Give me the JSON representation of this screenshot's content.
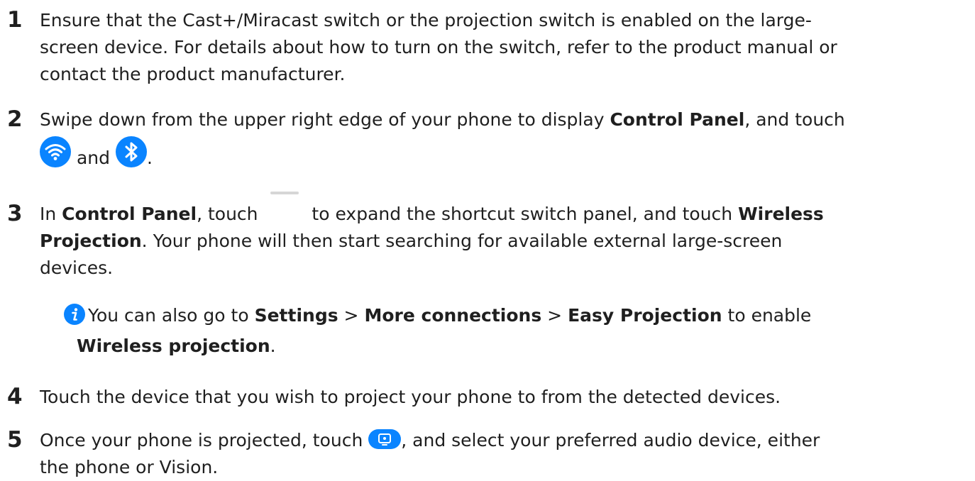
{
  "steps": [
    {
      "number": "1",
      "line1": "Ensure that the Cast+/Miracast switch or the projection switch is enabled on the large-",
      "line2": "screen device. For details about how to turn on the switch, refer to the product manual or",
      "line3": "contact the product manufacturer."
    },
    {
      "number": "2",
      "pre": "Swipe down from the upper right edge of your phone to display ",
      "bold1": "Control Panel",
      "mid": ", and touch",
      "and": "and",
      "end": "."
    },
    {
      "number": "3",
      "pre": "In ",
      "bold1": "Control Panel",
      "mid": ", touch",
      "mid2": "to expand the shortcut switch panel, and touch ",
      "bold2a": "Wireless",
      "bold2b": "Projection",
      "line2_rest": ". Your phone will then start searching for available external large-screen",
      "line3": "devices."
    },
    {
      "number": "4",
      "text": "Touch the device that you wish to project your phone to from the detected devices."
    },
    {
      "number": "5",
      "pre": "Once your phone is projected, touch",
      "post": ", and select your preferred audio device, either",
      "line2": "the phone or Vision."
    }
  ],
  "note": {
    "pre": "You can also go to ",
    "settings": "Settings",
    "sep1": " > ",
    "more": "More connections",
    "sep2": " > ",
    "easy": "Easy Projection",
    "post": " to enable",
    "bold_line2": "Wireless projection",
    "end": "."
  },
  "icons": {
    "wifi": "wifi-icon",
    "bluetooth": "bluetooth-icon",
    "expand": "expand-handle-icon",
    "info": "info-icon",
    "audio": "audio-switch-icon"
  },
  "colors": {
    "accent": "#0a84ff",
    "text": "#1f1f1f",
    "handle": "#d6d6d6"
  }
}
